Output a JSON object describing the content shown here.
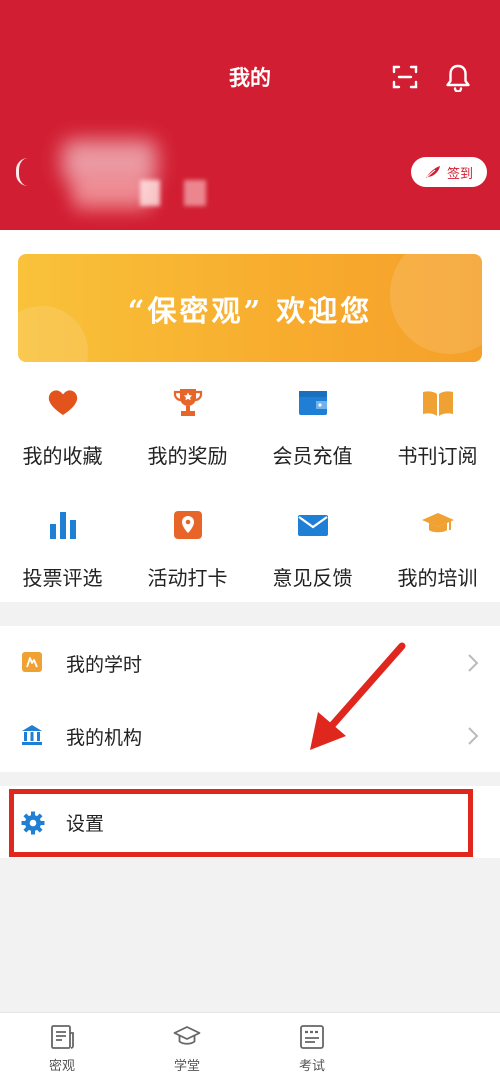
{
  "header": {
    "title": "我的",
    "checkin_label": "签到",
    "background_color": "#d21e32"
  },
  "banner": {
    "text": "“保密观” 欢迎您"
  },
  "grid": [
    {
      "label": "我的收藏",
      "icon": "heart-icon",
      "color": "#e2541b"
    },
    {
      "label": "我的奖励",
      "icon": "trophy-icon",
      "color": "#e8652a"
    },
    {
      "label": "会员充值",
      "icon": "wallet-icon",
      "color": "#1f7fd4"
    },
    {
      "label": "书刊订阅",
      "icon": "book-icon",
      "color": "#f0a133"
    },
    {
      "label": "投票评选",
      "icon": "bar-chart-icon",
      "color": "#1f7fd4"
    },
    {
      "label": "活动打卡",
      "icon": "location-pin-icon",
      "color": "#e8652a"
    },
    {
      "label": "意见反馈",
      "icon": "mail-icon",
      "color": "#1f7fd4"
    },
    {
      "label": "我的培训",
      "icon": "graduation-cap-icon",
      "color": "#f0a133"
    }
  ],
  "list": [
    {
      "label": "我的学时",
      "icon": "study-hours-icon"
    },
    {
      "label": "我的机构",
      "icon": "institution-icon"
    }
  ],
  "settings": {
    "label": "设置",
    "icon": "gear-icon"
  },
  "tabs": [
    {
      "label": "密观",
      "icon": "news-icon"
    },
    {
      "label": "学堂",
      "icon": "graduation-cap-icon"
    },
    {
      "label": "考试",
      "icon": "exam-icon"
    }
  ],
  "colors": {
    "accent_red": "#d21e32",
    "annotation_red": "#e0271e",
    "blue": "#1f7fd4",
    "orange": "#e8652a",
    "yellow": "#f0a133"
  }
}
